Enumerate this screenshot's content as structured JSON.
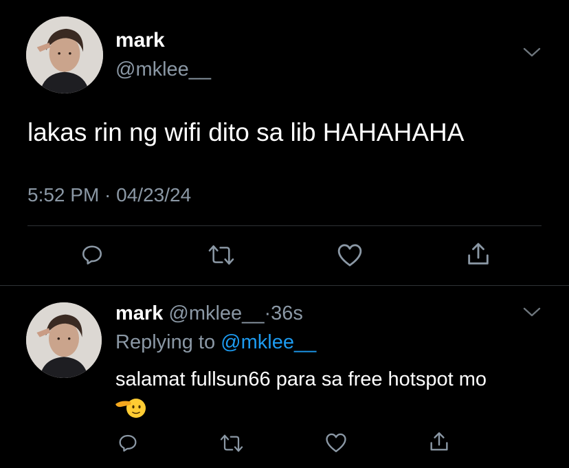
{
  "main_tweet": {
    "name": "mark",
    "handle": "@mklee__",
    "text": "lakas rin ng wifi dito sa lib HAHAHAHA",
    "timestamp": "5:52 PM · 04/23/24",
    "avatar_icon": "profile-photo",
    "menu_icon": "chevron-down-icon",
    "actions": [
      "reply-icon",
      "retweet-icon",
      "like-icon",
      "share-icon"
    ]
  },
  "reply_tweet": {
    "name": "mark",
    "handle": "@mklee__",
    "separator": "·",
    "time": "36s",
    "replying_prefix": "Replying to",
    "replying_handle": "@mklee__",
    "text": "salamat fullsun66 para sa free hotspot mo",
    "emoji": "saluting-face-emoji",
    "avatar_icon": "profile-photo",
    "menu_icon": "chevron-down-icon",
    "actions": [
      "reply-icon",
      "retweet-icon",
      "like-icon",
      "share-icon"
    ]
  },
  "colors": {
    "background": "#000000",
    "primary_text": "#ffffff",
    "secondary_text": "#8b98a5",
    "link": "#1d9bf0",
    "divider": "#2f3336"
  }
}
